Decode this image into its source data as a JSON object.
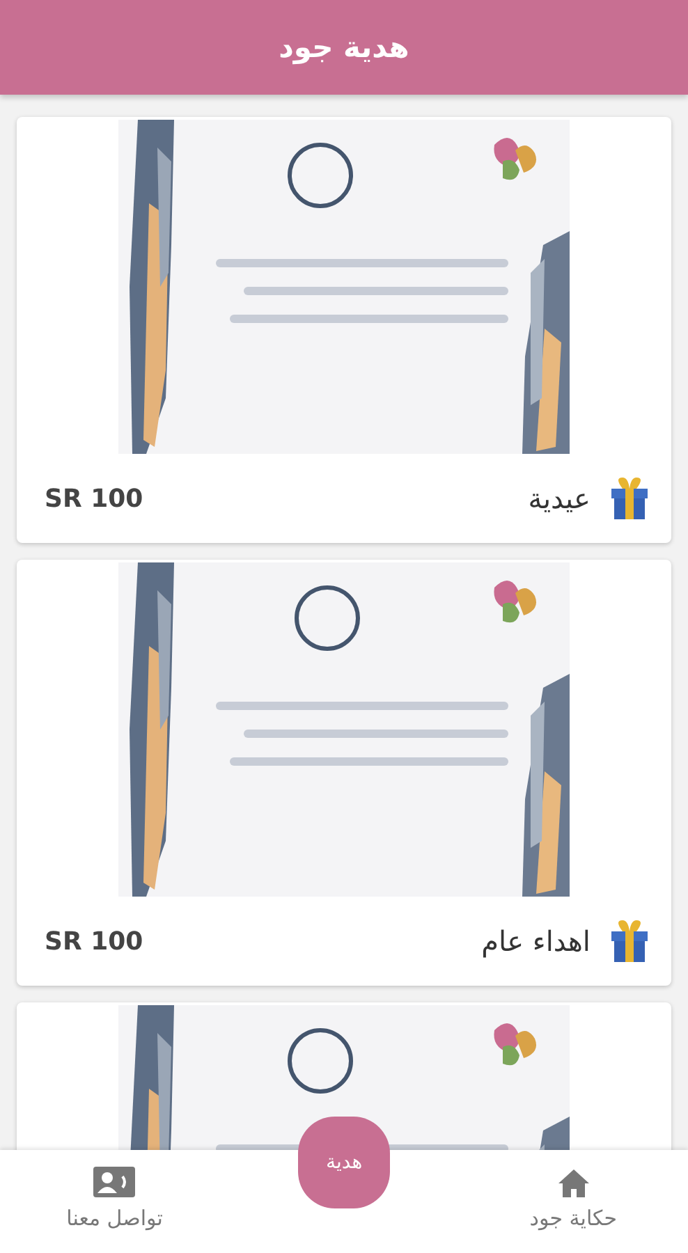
{
  "header": {
    "title": "هدية جود"
  },
  "cards": [
    {
      "kind": "gift",
      "title": "عيدية",
      "price": "SR 100"
    },
    {
      "kind": "gift",
      "title": "اهداء عام",
      "price": "SR 100"
    },
    {
      "kind": "picture"
    }
  ],
  "bottom_nav": [
    {
      "kind": "home",
      "label": "حكاية جود"
    },
    {
      "kind": "center",
      "label": "هدية"
    },
    {
      "kind": "contact",
      "label": "تواصل معنا"
    }
  ]
}
